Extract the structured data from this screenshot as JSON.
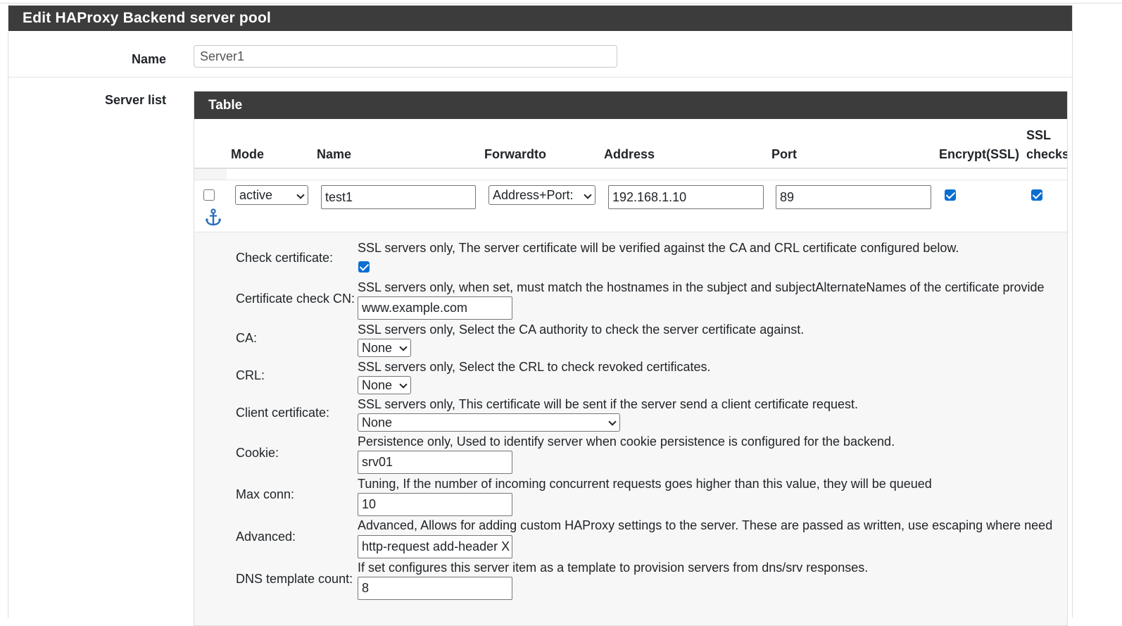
{
  "panel": {
    "title": "Edit HAProxy Backend server pool"
  },
  "name_field": {
    "label": "Name",
    "value": "Server1"
  },
  "server_list": {
    "label": "Server list",
    "table_title": "Table",
    "columns": {
      "mode": "Mode",
      "name": "Name",
      "forwardto": "Forwardto",
      "address": "Address",
      "port": "Port",
      "encrypt": "Encrypt(SSL)",
      "ssl_checks_line1": "SSL",
      "ssl_checks_line2": "checks"
    },
    "row": {
      "selected": false,
      "mode": "active",
      "name": "test1",
      "forwardto": "Address+Port:",
      "address": "192.168.1.10",
      "port": "89",
      "encrypt_ssl": true,
      "ssl_checks": true
    }
  },
  "details": {
    "check_certificate": {
      "label": "Check certificate:",
      "desc": "SSL servers only, The server certificate will be verified against the CA and CRL certificate configured below.",
      "checked": true
    },
    "certificate_cn": {
      "label": "Certificate check CN:",
      "desc": "SSL servers only, when set, must match the hostnames in the subject and subjectAlternateNames of the certificate provide",
      "value": "www.example.com"
    },
    "ca": {
      "label": "CA:",
      "desc": "SSL servers only, Select the CA authority to check the server certificate against.",
      "value": "None"
    },
    "crl": {
      "label": "CRL:",
      "desc": "SSL servers only, Select the CRL to check revoked certificates.",
      "value": "None"
    },
    "client_certificate": {
      "label": "Client certificate:",
      "desc": "SSL servers only, This certificate will be sent if the server send a client certificate request.",
      "value": "None"
    },
    "cookie": {
      "label": "Cookie:",
      "desc": "Persistence only, Used to identify server when cookie persistence is configured for the backend.",
      "value": "srv01"
    },
    "max_conn": {
      "label": "Max conn:",
      "desc": "Tuning, If the number of incoming concurrent requests goes higher than this value, they will be queued",
      "value": "10"
    },
    "advanced": {
      "label": "Advanced:",
      "desc": "Advanced, Allows for adding custom HAProxy settings to the server. These are passed as written, use escaping where need",
      "value": "http-request add-header X"
    },
    "dns_template": {
      "label": "DNS template count:",
      "desc": "If set configures this server item as a template to provision servers from dns/srv responses.",
      "value": "8"
    }
  },
  "icons": {
    "anchor": "anchor-icon",
    "chevron": "chevron-down-icon"
  },
  "colors": {
    "header_bg": "#3c3c3c",
    "checkbox_blue": "#0a6ed1",
    "anchor_blue": "#2a6fb8"
  }
}
